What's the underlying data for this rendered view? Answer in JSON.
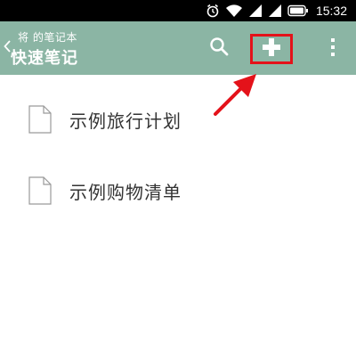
{
  "status_bar": {
    "time": "15:32",
    "icons": [
      "alarm-icon",
      "wifi-icon",
      "signal-icon",
      "signal-icon",
      "battery-icon"
    ]
  },
  "app_bar": {
    "subtitle": "将 的笔记本",
    "title": "快速笔记",
    "background": "#8bb5a4",
    "actions": [
      "search-icon",
      "plus-icon",
      "more-vertical-icon"
    ],
    "highlight_color": "#e4121a"
  },
  "notes": [
    {
      "title": "示例旅行计划",
      "icon": "document-icon"
    },
    {
      "title": "示例购物清单",
      "icon": "document-icon"
    }
  ]
}
